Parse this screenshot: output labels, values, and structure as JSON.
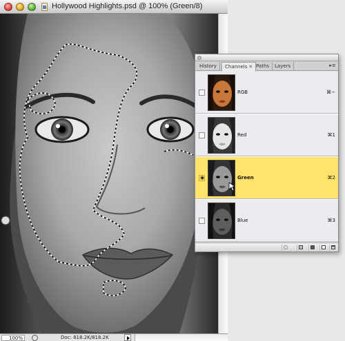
{
  "document": {
    "title": "Hollywood Highlights.psd @ 100% (Green/8)",
    "zoom": "100%",
    "doc_size": "Doc: 818.2K/818.2K"
  },
  "panel": {
    "tabs": [
      {
        "label": "History",
        "active": false
      },
      {
        "label": "Channels",
        "active": true
      },
      {
        "label": "Paths",
        "active": false
      },
      {
        "label": "Layers",
        "active": false
      }
    ],
    "channels": [
      {
        "name": "RGB",
        "shortcut": "⌘~",
        "visible": false,
        "selected": false
      },
      {
        "name": "Red",
        "shortcut": "⌘1",
        "visible": false,
        "selected": false
      },
      {
        "name": "Green",
        "shortcut": "⌘2",
        "visible": true,
        "selected": true
      },
      {
        "name": "Blue",
        "shortcut": "⌘3",
        "visible": false,
        "selected": false
      }
    ],
    "menu_icon": "panel-menu-icon",
    "footer_icons": [
      "load-selection-icon",
      "save-selection-icon",
      "spot-channel-icon",
      "new-channel-icon",
      "delete-channel-icon"
    ]
  },
  "colors": {
    "selected_row": "#ffe36a",
    "panel_bg": "#e6e6e6"
  }
}
